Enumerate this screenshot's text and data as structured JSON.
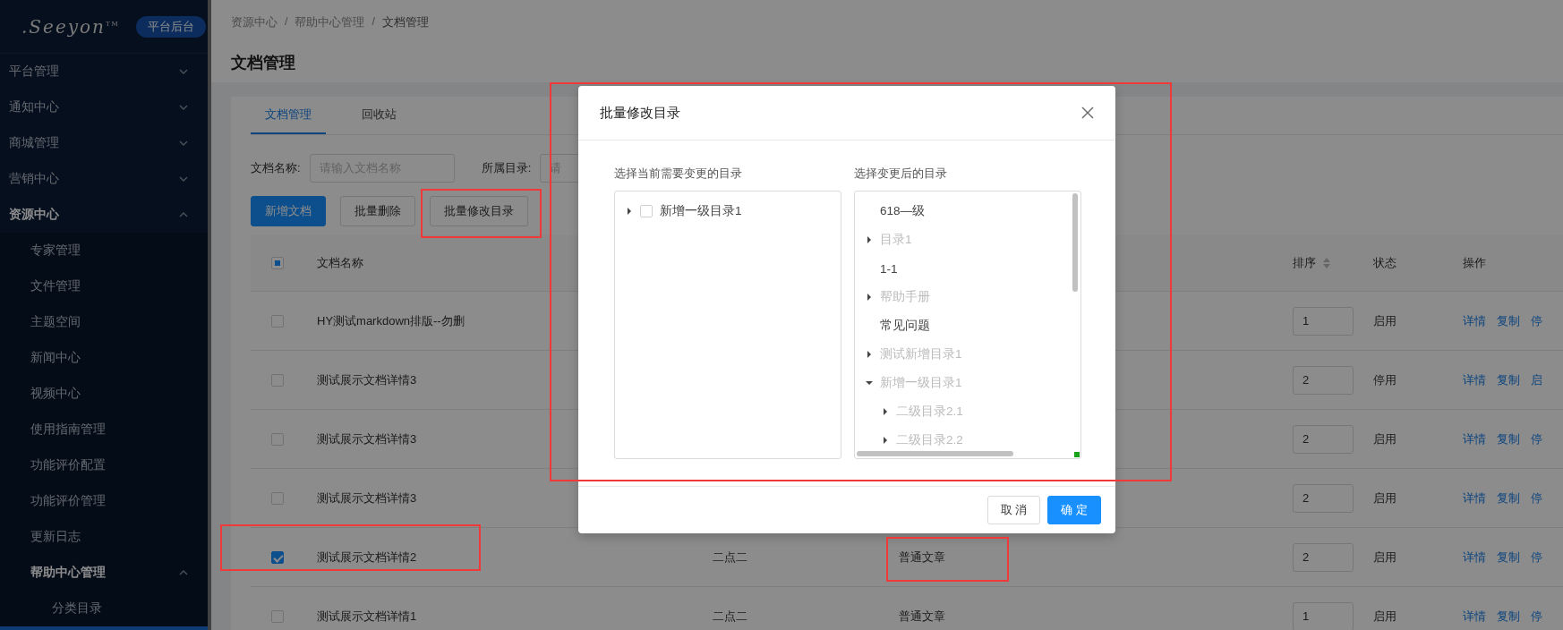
{
  "sidebar": {
    "logo": {
      "text": ".Seeyon",
      "mark": "TM"
    },
    "badge": "平台后台",
    "items": [
      {
        "label": "平台管理",
        "expanded": false
      },
      {
        "label": "通知中心",
        "expanded": false
      },
      {
        "label": "商城管理",
        "expanded": false
      },
      {
        "label": "营销中心",
        "expanded": false
      },
      {
        "label": "资源中心",
        "expanded": true,
        "children": [
          {
            "label": "专家管理"
          },
          {
            "label": "文件管理"
          },
          {
            "label": "主题空间"
          },
          {
            "label": "新闻中心"
          },
          {
            "label": "视频中心"
          },
          {
            "label": "使用指南管理"
          },
          {
            "label": "功能评价配置"
          },
          {
            "label": "功能评价管理"
          },
          {
            "label": "更新日志"
          },
          {
            "label": "帮助中心管理",
            "expanded": true,
            "children": [
              {
                "label": "分类目录"
              }
            ]
          }
        ]
      }
    ]
  },
  "breadcrumb": {
    "separator": "/",
    "items": [
      "资源中心",
      "帮助中心管理",
      "文档管理"
    ]
  },
  "page_title": "文档管理",
  "tabs": [
    {
      "label": "文档管理",
      "selected": true
    },
    {
      "label": "回收站",
      "selected": false
    }
  ],
  "filters": [
    {
      "label": "文档名称:",
      "placeholder": "请输入文档名称"
    },
    {
      "label": "所属目录:",
      "placeholder": "请"
    }
  ],
  "buttons": [
    {
      "label": "新增文档",
      "kind": "primary"
    },
    {
      "label": "批量删除",
      "kind": "default"
    },
    {
      "label": "批量修改目录",
      "kind": "default"
    }
  ],
  "table": {
    "select_all": {
      "indeterminate": true
    },
    "columns": [
      {
        "label": "文档名称",
        "kind": "plain"
      },
      {
        "label": "排序",
        "kind": "sortable"
      },
      {
        "label": "状态",
        "kind": "plain"
      },
      {
        "label": "操作",
        "kind": "plain"
      }
    ],
    "rows": [
      {
        "selected": false,
        "name": "HY测试markdown排版--勿删",
        "order": "1",
        "status": "启用",
        "actions": [
          "详情",
          "复制",
          "停"
        ]
      },
      {
        "selected": false,
        "name": "测试展示文档详情3",
        "order": "2",
        "status": "停用",
        "actions": [
          "详情",
          "复制",
          "启"
        ]
      },
      {
        "selected": false,
        "name": "测试展示文档详情3",
        "order": "2",
        "status": "启用",
        "actions": [
          "详情",
          "复制",
          "停"
        ]
      },
      {
        "selected": false,
        "name": "测试展示文档详情3",
        "order": "2",
        "status": "启用",
        "actions": [
          "详情",
          "复制",
          "停"
        ]
      },
      {
        "selected": true,
        "name": "测试展示文档详情2",
        "column_3": "二点二",
        "column_4": "普通文章",
        "order": "2",
        "status": "启用",
        "actions": [
          "详情",
          "复制",
          "停"
        ]
      },
      {
        "selected": false,
        "name": "测试展示文档详情1",
        "column_3": "二点二",
        "column_4": "普通文章",
        "order": "1",
        "status": "启用",
        "actions": [
          "详情",
          "复制",
          "停"
        ]
      }
    ]
  },
  "dialog": {
    "title": "批量修改目录",
    "source": {
      "label": "选择当前需要变更的目录",
      "tree": [
        {
          "label": "新增一级目录1",
          "expanded": false,
          "checked": false
        }
      ]
    },
    "target": {
      "label": "选择变更后的目录",
      "tree": [
        {
          "label": "618—级",
          "disabled": false
        },
        {
          "label": "目录1",
          "disabled": true,
          "expanded": false
        },
        {
          "label": "1-1",
          "disabled": false
        },
        {
          "label": "帮助手册",
          "disabled": true,
          "expanded": false
        },
        {
          "label": "常见问题",
          "disabled": false
        },
        {
          "label": "测试新增目录1",
          "disabled": true,
          "expanded": false
        },
        {
          "label": "新增一级目录1",
          "disabled": true,
          "expanded": true,
          "children": [
            {
              "label": "二级目录2.1",
              "disabled": true,
              "expanded": false
            },
            {
              "label": "二级目录2.2",
              "disabled": true,
              "expanded": false
            }
          ]
        }
      ]
    },
    "buttons": [
      {
        "label": "取 消",
        "kind": "default"
      },
      {
        "label": "确 定",
        "kind": "primary"
      }
    ]
  }
}
